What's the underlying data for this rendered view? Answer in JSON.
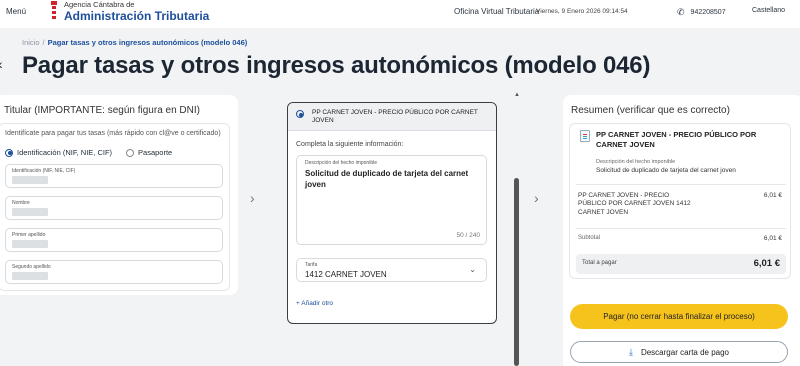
{
  "header": {
    "menu": "Menú",
    "logo_sub": "Agencia Cántabra de",
    "logo_main": "Administración Tributaria",
    "oficina": "Oficina Virtual Tributaria",
    "fecha": "Viernes, 9 Enero 2026 09:14:54",
    "phone": "942208507",
    "language": "Castellano"
  },
  "breadcrumb": {
    "home": "Inicio",
    "separator": "/",
    "current": "Pagar tasas y otros ingresos autonómicos (modelo 046)"
  },
  "page": {
    "title": "Pagar tasas y otros ingresos autonómicos (modelo 046)"
  },
  "titular": {
    "title": "Titular (IMPORTANTE: según figura en DNI)",
    "hint": "Identifícate para pagar tus tasas (más rápido con cl@ve o certificado)",
    "radio_ident": "Identificación (NIF, NIE, CIF)",
    "radio_pasaporte": "Pasaporte",
    "fields": [
      {
        "label": "Identificación (NIF, NIE, CIF)"
      },
      {
        "label": "Nombre"
      },
      {
        "label": "Primer apellido"
      },
      {
        "label": "Segundo apellido"
      }
    ]
  },
  "concepto": {
    "heading": "PP CARNET JOVEN - PRECIO PÚBLICO POR CARNET JOVEN",
    "subheading": "Completa la siguiente información:",
    "desc_label": "Descripción del hecho imponible",
    "desc_value": "Solicitud de duplicado de tarjeta del carnet joven",
    "desc_count": "50 / 240",
    "tarifa_label": "Tarifa",
    "tarifa_value": "1412 CARNET JOVEN",
    "add_other": "+ Añadir otro"
  },
  "resumen": {
    "title": "Resumen (verificar que es correcto)",
    "item_title": "PP CARNET JOVEN - PRECIO PÚBLICO POR CARNET JOVEN",
    "desc_label": "Descripción del hecho imponible",
    "desc_value": "Solicitud de duplicado de tarjeta del carnet joven",
    "line_name": "PP CARNET JOVEN - PRECIO PÚBLICO POR CARNET JOVEN 1412 CARNET JOVEN",
    "line_amount": "6,01 €",
    "subtotal_label": "Subtotal",
    "subtotal_amount": "6,01 €",
    "total_label": "Total a pagar",
    "total_amount": "6,01 €"
  },
  "actions": {
    "pay": "Pagar (no cerrar hasta finalizar el proceso)",
    "download": "Descargar carta de pago"
  },
  "colors": {
    "accent": "#1d4f9c",
    "pay_button": "#f6c31c"
  }
}
